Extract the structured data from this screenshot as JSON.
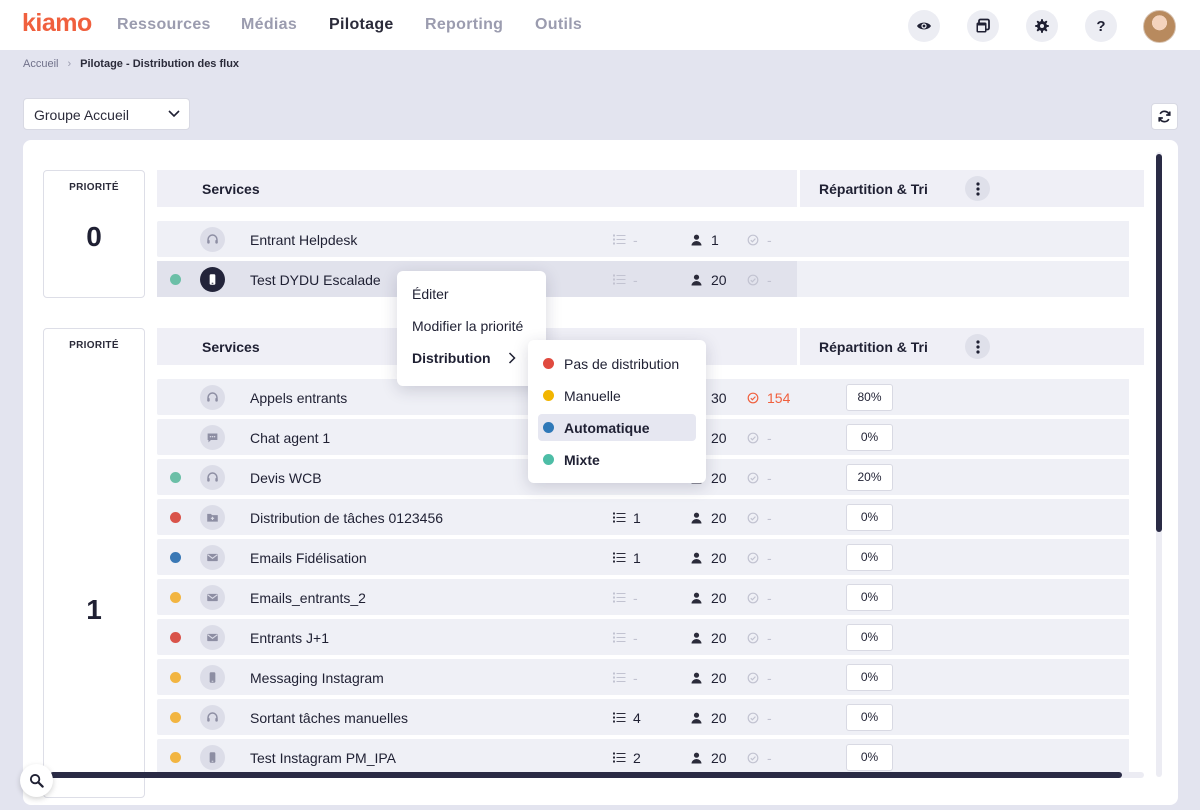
{
  "app": {
    "logo": "kiamo"
  },
  "nav": {
    "items": [
      {
        "label": "Ressources",
        "active": false
      },
      {
        "label": "Médias",
        "active": false
      },
      {
        "label": "Pilotage",
        "active": true
      },
      {
        "label": "Reporting",
        "active": false
      },
      {
        "label": "Outils",
        "active": false
      }
    ]
  },
  "topbar_icons": [
    "eye-icon",
    "windows-icon",
    "gear-icon",
    "help-icon"
  ],
  "breadcrumb": {
    "root": "Accueil",
    "current": "Pilotage - Distribution des flux"
  },
  "group_select": {
    "value": "Groupe Accueil"
  },
  "table_headers": {
    "services": "Services",
    "repartition": "Répartition & Tri",
    "priority": "PRIORITÉ"
  },
  "priorities": [
    {
      "label": "PRIORITÉ",
      "number": "0"
    },
    {
      "label": "PRIORITÉ",
      "number": "1"
    }
  ],
  "priority0_rows": [
    {
      "dot": null,
      "icon": "headset-icon",
      "name": "Entrant Helpdesk",
      "queue": "-",
      "agents": "1",
      "waiting": "-",
      "pct": null
    },
    {
      "dot": "#6bbfa7",
      "icon": "mobile-icon",
      "name": "Test DYDU Escalade",
      "queue": "-",
      "agents": "20",
      "waiting": "-",
      "pct": null
    }
  ],
  "priority1_rows": [
    {
      "dot": null,
      "icon": "headset-icon",
      "name": "Appels entrants",
      "queue": "",
      "agents": "30",
      "waiting": "154",
      "pct": "80%"
    },
    {
      "dot": null,
      "icon": "chat-icon",
      "name": "Chat agent 1",
      "queue": "",
      "agents": "20",
      "waiting": "-",
      "pct": "0%"
    },
    {
      "dot": "#6bbfa7",
      "icon": "headset-icon",
      "name": "Devis WCB",
      "queue": "",
      "agents": "20",
      "waiting": "-",
      "pct": "20%"
    },
    {
      "dot": "#d9534a",
      "icon": "folder-icon",
      "name": "Distribution de tâches 0123456",
      "queue": "1",
      "agents": "20",
      "waiting": "-",
      "pct": "0%"
    },
    {
      "dot": "#3a78b5",
      "icon": "mail-icon",
      "name": "Emails Fidélisation",
      "queue": "1",
      "agents": "20",
      "waiting": "-",
      "pct": "0%"
    },
    {
      "dot": "#f2b541",
      "icon": "mail-icon",
      "name": "Emails_entrants_2",
      "queue": "-",
      "agents": "20",
      "waiting": "-",
      "pct": "0%"
    },
    {
      "dot": "#d9534a",
      "icon": "mail-icon",
      "name": "Entrants J+1",
      "queue": "-",
      "agents": "20",
      "waiting": "-",
      "pct": "0%"
    },
    {
      "dot": "#f2b541",
      "icon": "mobile-icon",
      "name": "Messaging Instagram",
      "queue": "-",
      "agents": "20",
      "waiting": "-",
      "pct": "0%"
    },
    {
      "dot": "#f2b541",
      "icon": "headset-icon",
      "name": "Sortant tâches manuelles",
      "queue": "4",
      "agents": "20",
      "waiting": "-",
      "pct": "0%"
    },
    {
      "dot": "#f2b541",
      "icon": "mobile-icon",
      "name": "Test Instagram PM_IPA",
      "queue": "2",
      "agents": "20",
      "waiting": "-",
      "pct": "0%"
    }
  ],
  "context_menu": {
    "items": [
      "Éditer",
      "Modifier la priorité",
      "Distribution"
    ]
  },
  "distribution_submenu": {
    "items": [
      {
        "label": "Pas de distribution",
        "color": "#e04a3f",
        "highlighted": false,
        "bold": false
      },
      {
        "label": "Manuelle",
        "color": "#f2b500",
        "highlighted": false,
        "bold": false
      },
      {
        "label": "Automatique",
        "color": "#2f79b8",
        "highlighted": true,
        "bold": true
      },
      {
        "label": "Mixte",
        "color": "#4dbda6",
        "highlighted": false,
        "bold": true
      }
    ]
  }
}
